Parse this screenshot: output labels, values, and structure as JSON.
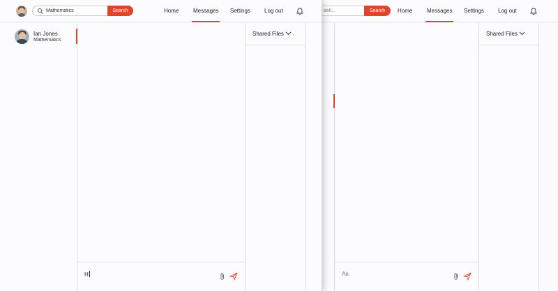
{
  "colors": {
    "accent": "#e0442b",
    "border": "#dcdce0",
    "background": "#fcfbfd"
  },
  "front": {
    "search": {
      "value": "Mathematics",
      "button_label": "Search"
    },
    "nav": {
      "home": "Home",
      "messages": "Messages",
      "settings": "Settings",
      "logout": "Log out",
      "active": "messages"
    },
    "contacts": [
      {
        "name": "Ian Jones",
        "preview": "Mathematics"
      }
    ],
    "composer": {
      "value": "H"
    },
    "files": {
      "label": "Shared Files"
    }
  },
  "back": {
    "search": {
      "placeholder": "k skill...",
      "button_label": "Search"
    },
    "nav": {
      "home": "Home",
      "messages": "Messages",
      "settings": "Settings",
      "logout": "Log out",
      "active": "messages"
    },
    "composer": {
      "placeholder": "Aa"
    },
    "files": {
      "label": "Shared Files"
    }
  },
  "icons": [
    "search-icon",
    "bell-icon",
    "paperclip-icon",
    "send-icon",
    "chevron-down-icon"
  ]
}
